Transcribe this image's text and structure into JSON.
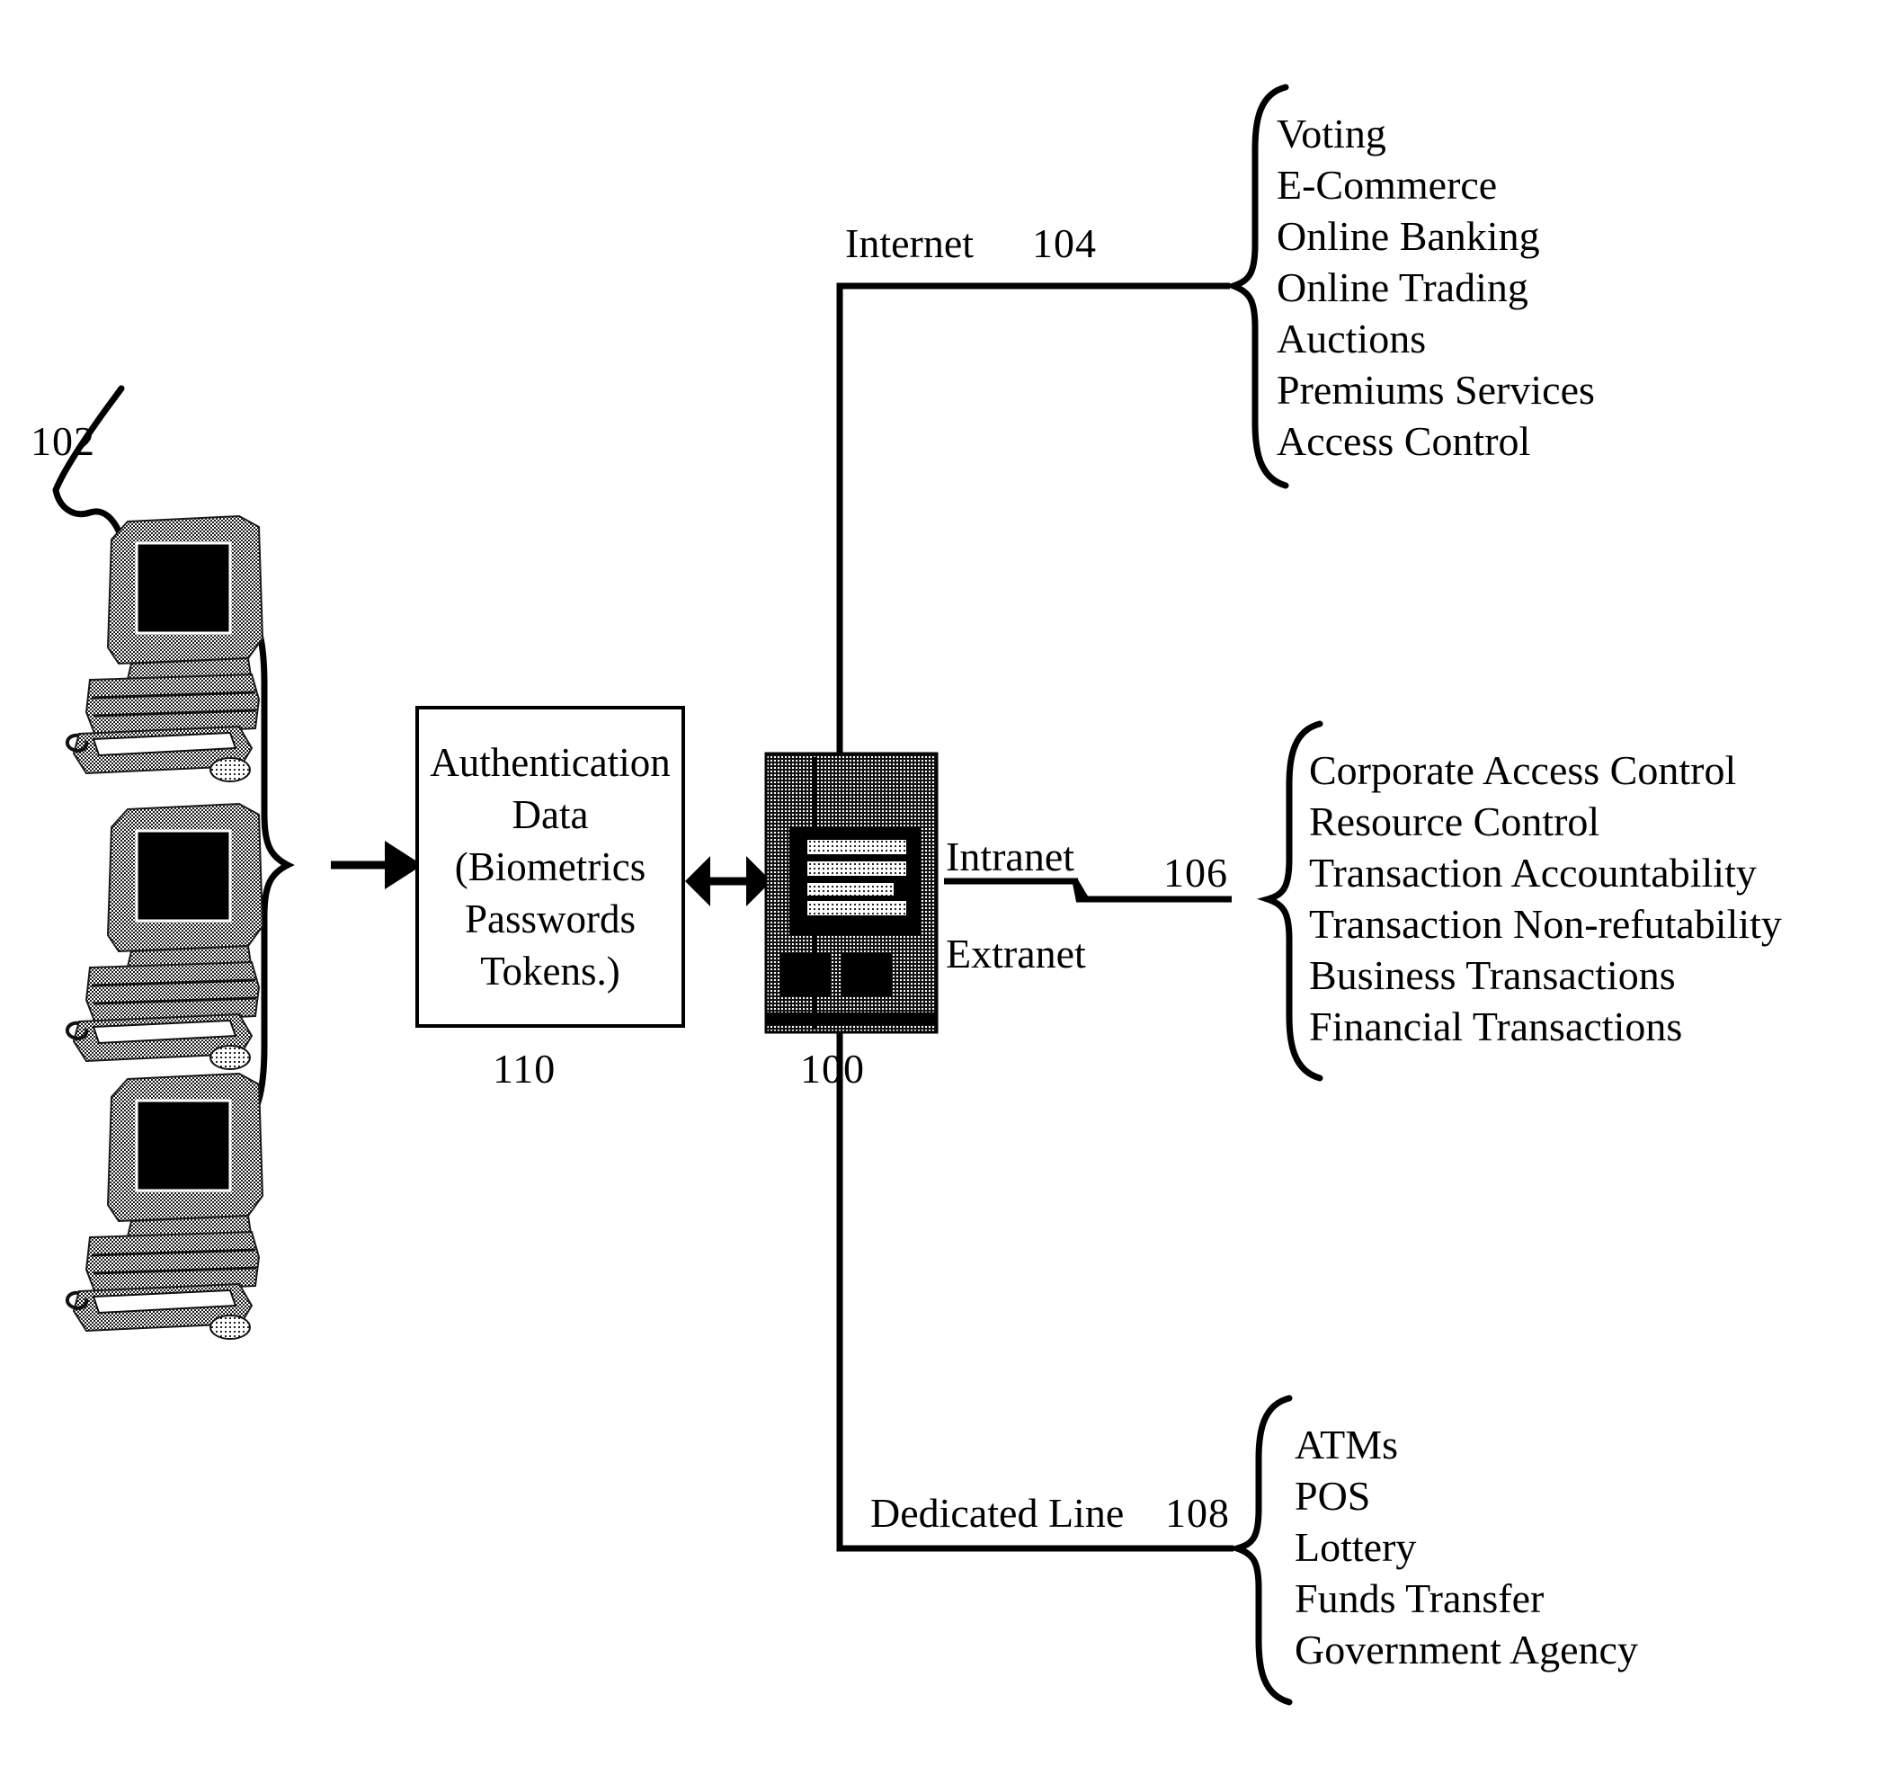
{
  "figure": {
    "type": "patent-network-diagram",
    "reference_numerals": {
      "clients": "102",
      "server": "100",
      "auth_data": "110",
      "internet_branch": "104",
      "intranet_branch": "106",
      "dedicated_line_branch": "108"
    }
  },
  "clients": {
    "label": "102",
    "icon": "desktop-computer-icon",
    "count": 3
  },
  "auth_box": {
    "lines": [
      "Authentication",
      "Data",
      "(Biometrics",
      "Passwords",
      "Tokens.)"
    ],
    "label": "110"
  },
  "server": {
    "icon": "server-rack-icon",
    "label": "100"
  },
  "branches": [
    {
      "name": "internet",
      "link_labels": [
        "Internet"
      ],
      "ref": "104",
      "items": [
        "Voting",
        "E-Commerce",
        "Online Banking",
        "Online Trading",
        "Auctions",
        "Premiums Services",
        "Access Control"
      ]
    },
    {
      "name": "intranet-extranet",
      "link_labels": [
        "Intranet",
        "Extranet"
      ],
      "ref": "106",
      "items": [
        "Corporate Access Control",
        "Resource Control",
        "Transaction Accountability",
        "Transaction Non-refutability",
        "Business Transactions",
        "Financial Transactions"
      ]
    },
    {
      "name": "dedicated-line",
      "link_labels": [
        "Dedicated Line"
      ],
      "ref": "108",
      "items": [
        "ATMs",
        "POS",
        "Lottery",
        "Funds Transfer",
        " Government Agency"
      ]
    }
  ],
  "colors": {
    "ink": "#000000",
    "paper": "#ffffff"
  }
}
